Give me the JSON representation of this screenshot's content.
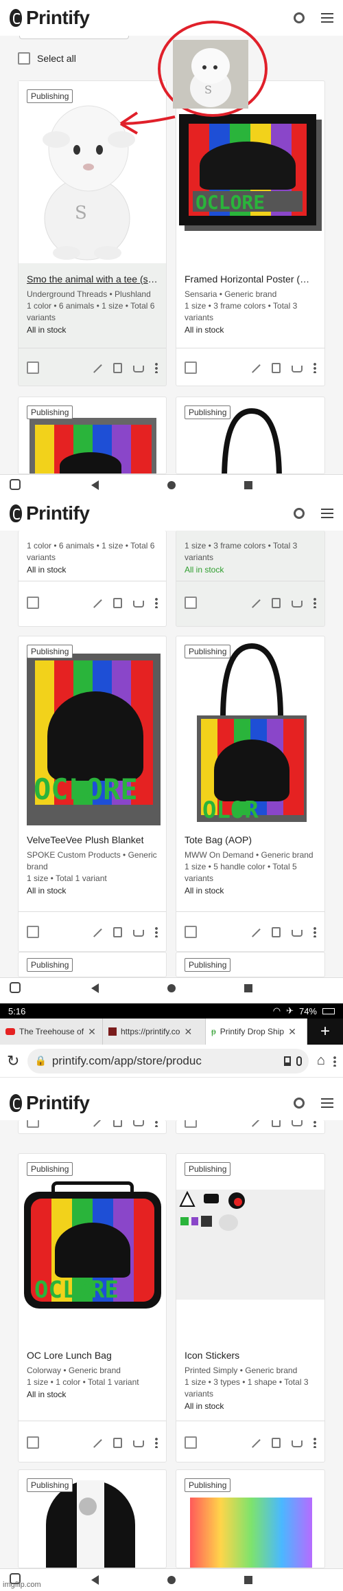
{
  "app": {
    "logo": "Printify"
  },
  "select_all": "Select all",
  "status_label": "Publishing",
  "panel1": {
    "cards": [
      {
        "title": "Smo the animal with a tee (sp...",
        "meta1": "Underground Threads • Plushland",
        "meta2": "1 color • 6 animals • 1 size • Total 6",
        "meta3": "variants",
        "stock": "All in stock"
      },
      {
        "title": "Framed Horizontal Poster (ma...",
        "meta1": "Sensaria • Generic brand",
        "meta2": "1 size • 3 frame colors • Total 3",
        "meta3": "variants",
        "stock": "All in stock"
      }
    ]
  },
  "panel2": {
    "top_left": {
      "meta2": "1 color • 6 animals • 1 size • Total 6",
      "meta3": "variants",
      "stock": "All in stock"
    },
    "top_right": {
      "meta2": "1 size • 3 frame colors • Total 3",
      "meta3": "variants",
      "stock": "All in stock"
    },
    "cards": [
      {
        "title": "VelveTeeVee Plush Blanket",
        "meta1": "SPOKE Custom Products • Generic",
        "meta1b": "brand",
        "meta2": "1 size • Total 1 variant",
        "stock": "All in stock"
      },
      {
        "title": "Tote Bag (AOP)",
        "meta1": "MWW On Demand • Generic brand",
        "meta2": "1 size • 5 handle color • Total 5",
        "meta3": "variants",
        "stock": "All in stock"
      }
    ]
  },
  "browser": {
    "time": "5:16",
    "battery": "74%",
    "tabs": [
      {
        "label": "The Treehouse of"
      },
      {
        "label": "https://printify.co"
      },
      {
        "label": "Printify Drop Ship"
      }
    ],
    "new_tab": "+",
    "url": "printify.com/app/store/produc"
  },
  "panel3": {
    "cards": [
      {
        "title": "OC Lore Lunch Bag",
        "meta1": "Colorway • Generic brand",
        "meta2": "1 size • 1 color • Total 1 variant",
        "stock": "All in stock"
      },
      {
        "title": "Icon Stickers",
        "meta1": "Printed Simply • Generic brand",
        "meta2": "1 size • 3 types • 1 shape • Total 3",
        "meta3": "variants",
        "stock": "All in stock"
      }
    ]
  },
  "watermark": "imgflip.com",
  "colors": {
    "stock_green": "#2e9e2e",
    "annotation_red": "#e0202a",
    "accent_active_tab": "#2e9e2e"
  }
}
